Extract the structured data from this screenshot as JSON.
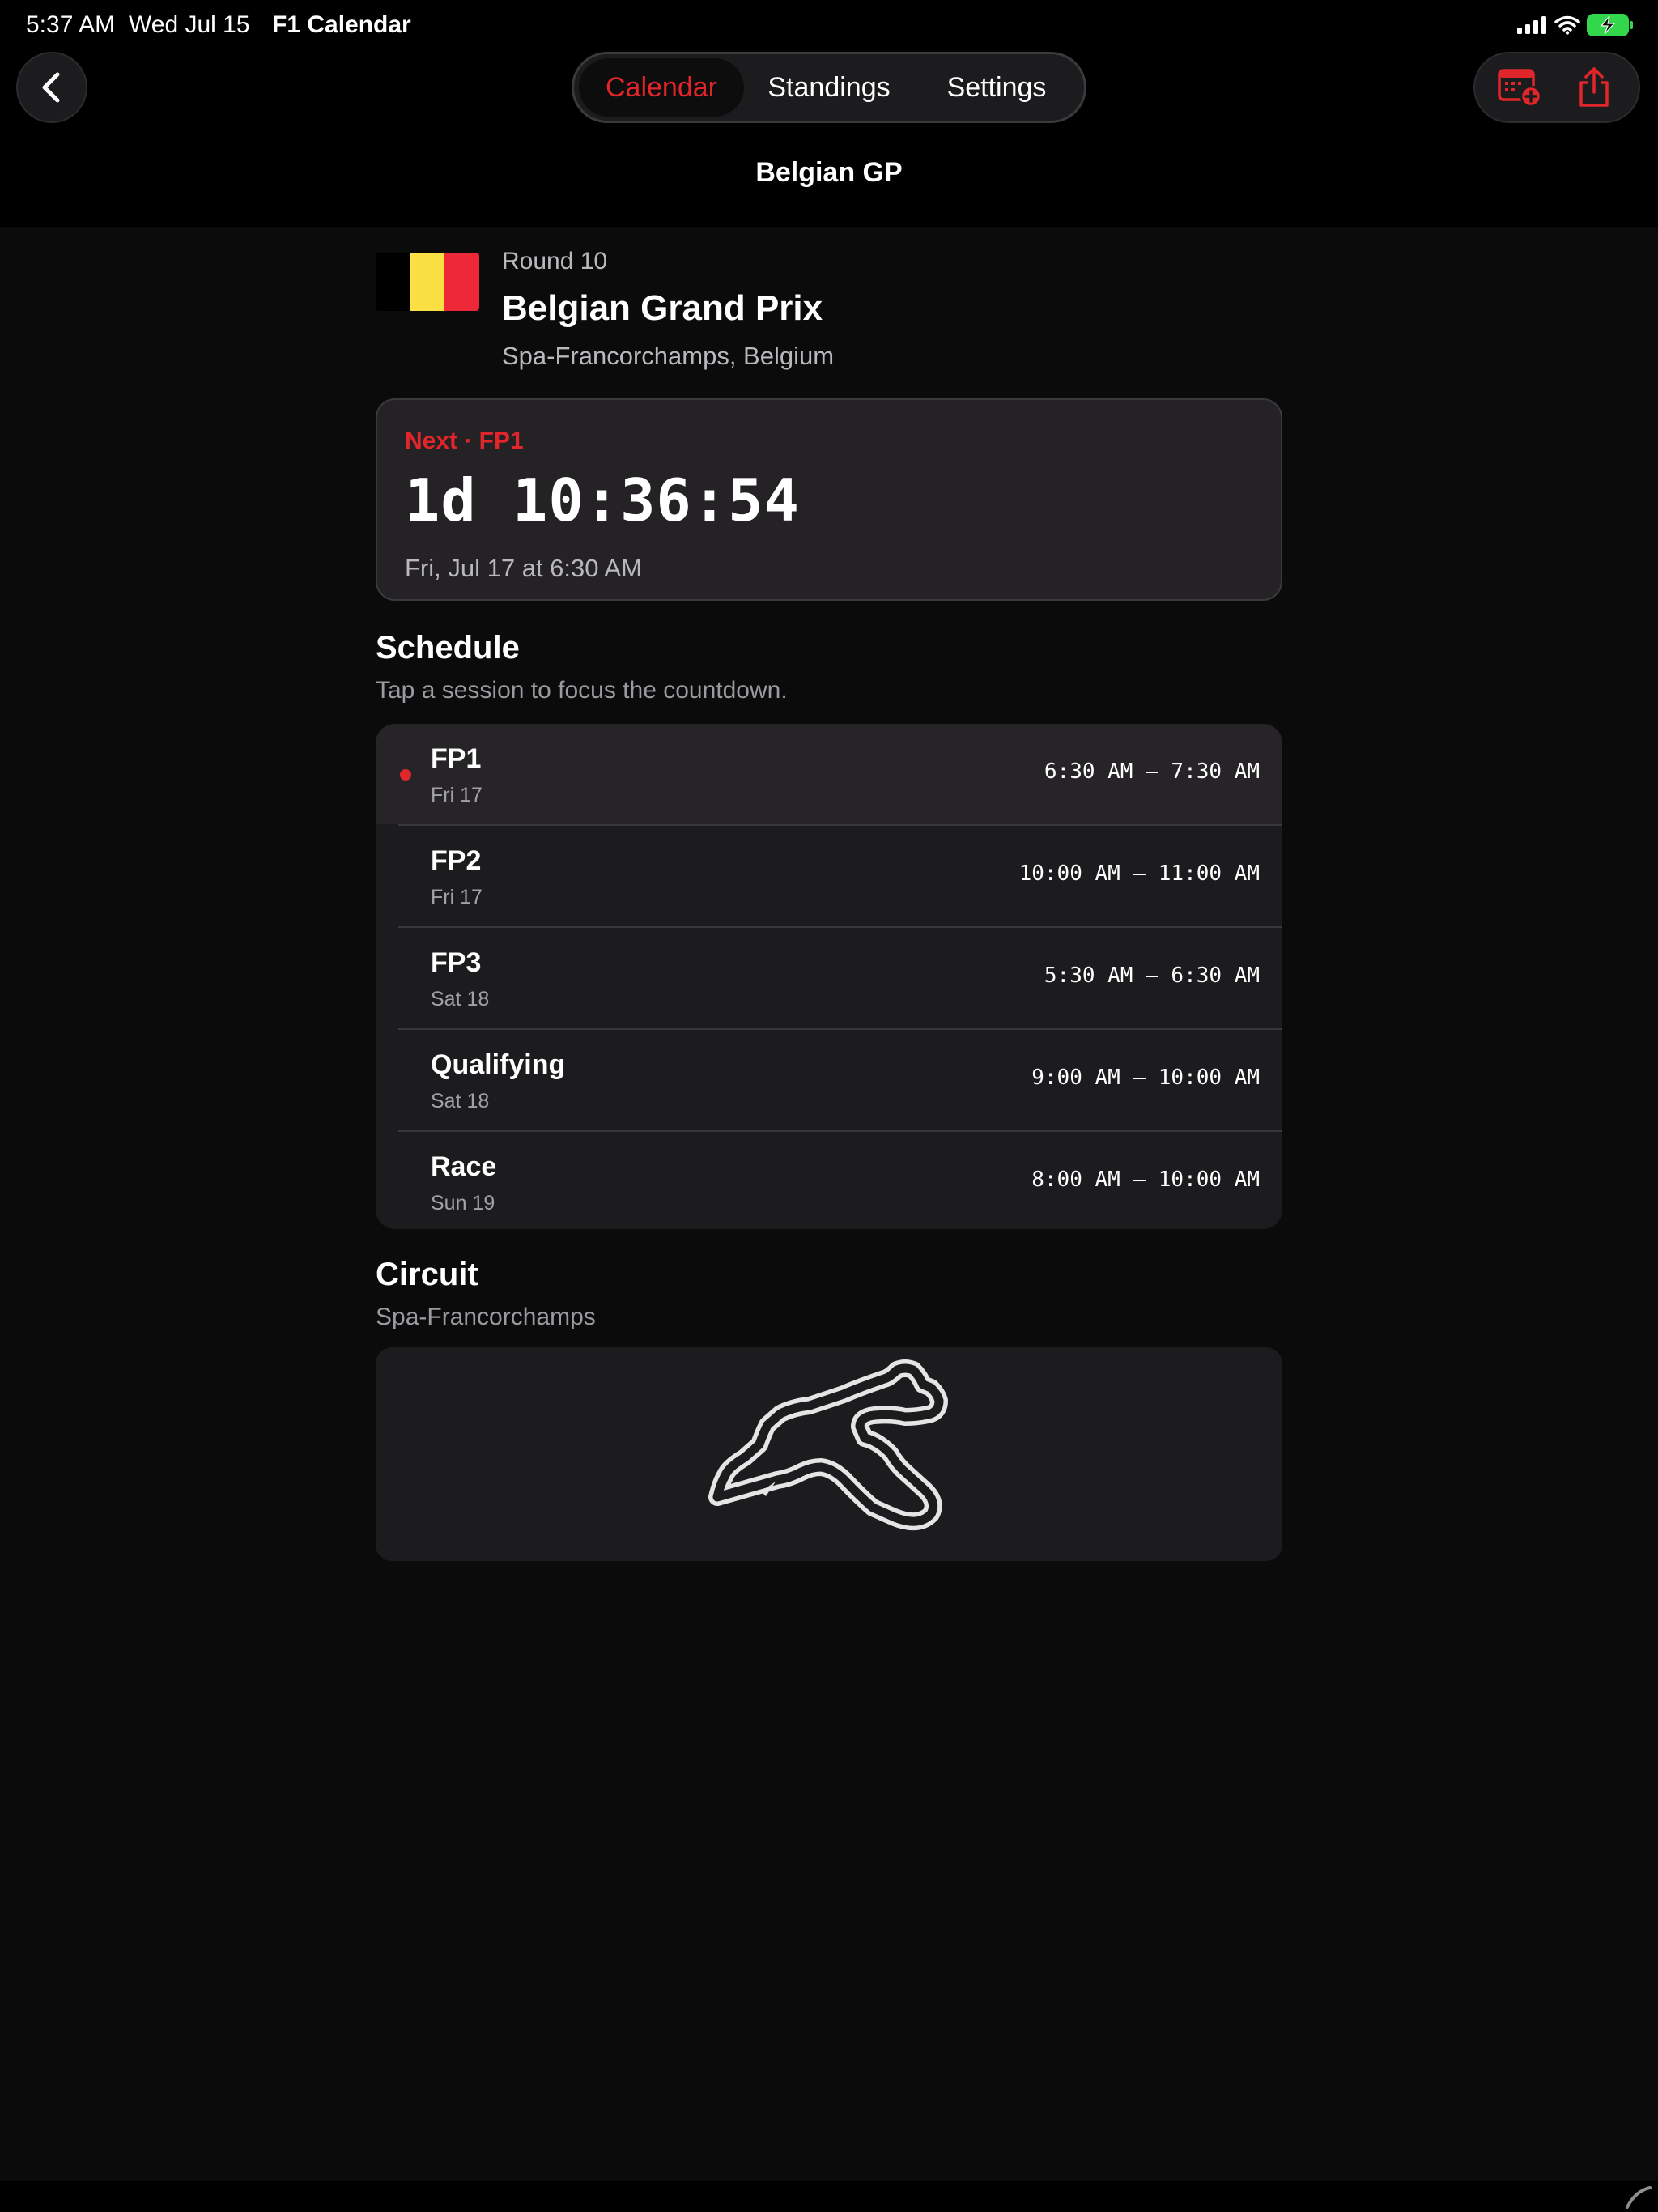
{
  "status_bar": {
    "time": "5:37 AM",
    "date": "Wed Jul 15",
    "app_name": "F1 Calendar",
    "battery_color": "#32d74b"
  },
  "nav": {
    "tabs": [
      {
        "label": "Calendar",
        "active": true
      },
      {
        "label": "Standings",
        "active": false
      },
      {
        "label": "Settings",
        "active": false
      }
    ],
    "title": "Belgian GP",
    "icons": [
      "back-chevron-icon",
      "add-to-calendar-icon",
      "share-icon"
    ]
  },
  "race": {
    "round": "Round 10",
    "name": "Belgian Grand Prix",
    "location": "Spa-Francorchamps, Belgium",
    "flag_colors": [
      "#000000",
      "#fae042",
      "#ed2939"
    ]
  },
  "countdown": {
    "label": "Next · FP1",
    "value": "1d 10:36:54",
    "datetime": "Fri, Jul 17 at 6:30 AM"
  },
  "schedule": {
    "title": "Schedule",
    "subtitle": "Tap a session to focus the countdown.",
    "sessions": [
      {
        "name": "FP1",
        "day": "Fri 17",
        "time": "6:30 AM — 7:30 AM",
        "selected": true
      },
      {
        "name": "FP2",
        "day": "Fri 17",
        "time": "10:00 AM — 11:00 AM",
        "selected": false
      },
      {
        "name": "FP3",
        "day": "Sat 18",
        "time": "5:30 AM — 6:30 AM",
        "selected": false
      },
      {
        "name": "Qualifying",
        "day": "Sat 18",
        "time": "9:00 AM — 10:00 AM",
        "selected": false
      },
      {
        "name": "Race",
        "day": "Sun 19",
        "time": "8:00 AM — 10:00 AM",
        "selected": false
      }
    ]
  },
  "circuit": {
    "title": "Circuit",
    "name": "Spa-Francorchamps"
  },
  "colors": {
    "accent": "#e0262b",
    "background": "#0b0b0b",
    "card": "#1c1b1d"
  }
}
